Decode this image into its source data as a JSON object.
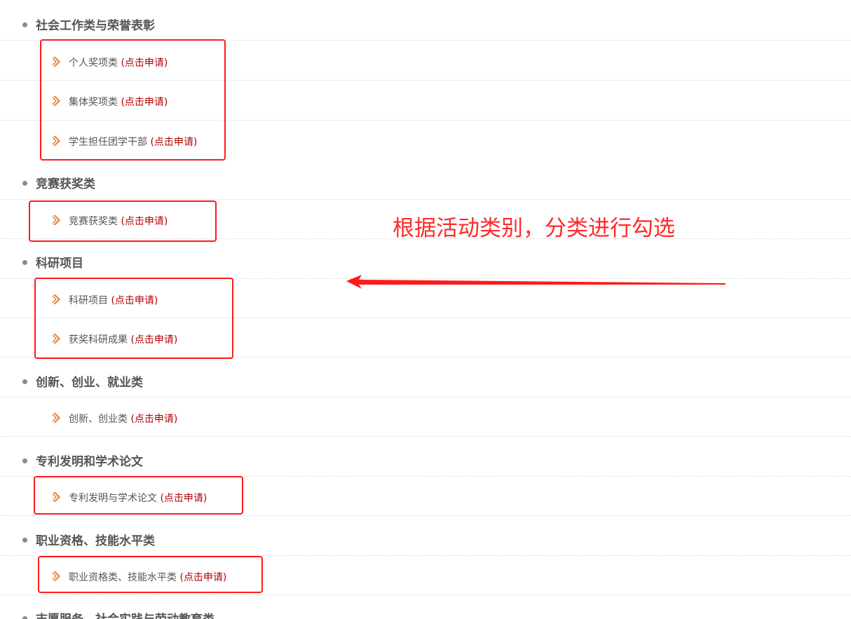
{
  "apply_label": "(点击申请)",
  "annotation": {
    "text": "根据活动类别，分类进行勾选",
    "color": "#ff2a2a"
  },
  "colors": {
    "category_text": "#555555",
    "item_text": "#555555",
    "apply_link": "#b00000",
    "highlight_box": "#ff1a1a",
    "arrow_icon": "#f08030"
  },
  "sections": [
    {
      "title": "社会工作类与荣誉表彰",
      "items": [
        "个人奖项类",
        "集体奖项类",
        "学生担任团学干部"
      ]
    },
    {
      "title": "竞赛获奖类",
      "items": [
        "竞赛获奖类"
      ]
    },
    {
      "title": "科研项目",
      "items": [
        "科研项目",
        "获奖科研成果"
      ]
    },
    {
      "title": "创新、创业、就业类",
      "items": [
        "创新、创业类"
      ]
    },
    {
      "title": "专利发明和学术论文",
      "items": [
        "专利发明与学术论文"
      ]
    },
    {
      "title": "职业资格、技能水平类",
      "items": [
        "职业资格类、技能水平类"
      ]
    },
    {
      "title": "志愿服务、社会实践与劳动教育类",
      "items": []
    }
  ]
}
